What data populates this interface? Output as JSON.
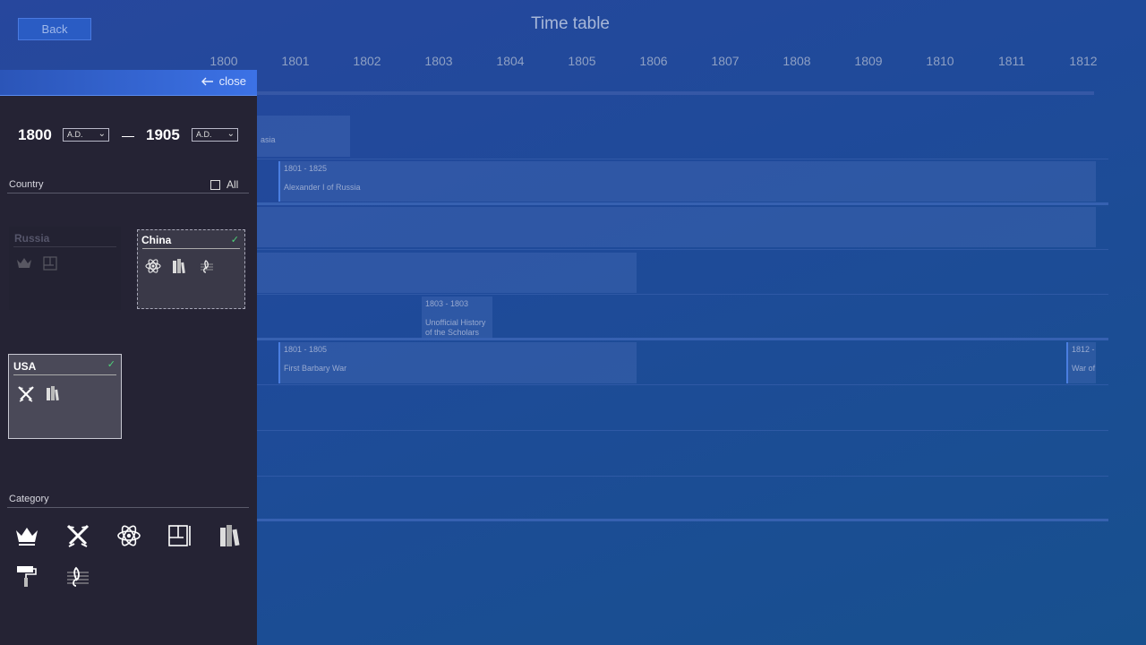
{
  "header": {
    "back_label": "Back",
    "title": "Time table"
  },
  "timeline": {
    "years": [
      "1800",
      "1801",
      "1802",
      "1803",
      "1804",
      "1805",
      "1806",
      "1807",
      "1808",
      "1809",
      "1810",
      "1811",
      "1812"
    ],
    "events": [
      {
        "dates": "",
        "name": "asia"
      },
      {
        "dates": "1801 - 1825",
        "name": "Alexander I of Russia"
      },
      {
        "dates": "1803 - 1803",
        "name": "Unofficial History of the Scholars"
      },
      {
        "dates": "1801 - 1805",
        "name": "First Barbary War"
      },
      {
        "dates": "1812 -",
        "name": "War of"
      }
    ]
  },
  "filter": {
    "close_label": "close",
    "start_year": "1800",
    "start_era": "A.D.",
    "end_year": "1905",
    "end_era": "A.D.",
    "country_label": "Country",
    "all_label": "All",
    "countries": [
      {
        "name": "Russia",
        "selected": false,
        "icons": [
          "crown-icon",
          "map-icon"
        ]
      },
      {
        "name": "China",
        "selected": true,
        "icons": [
          "atom-icon",
          "books-icon",
          "music-icon"
        ]
      },
      {
        "name": "USA",
        "selected": true,
        "icons": [
          "crossed-swords-icon",
          "books-icon"
        ]
      }
    ],
    "check_mark": "✓",
    "category_label": "Category",
    "categories": [
      "crown-icon",
      "crossed-swords-icon",
      "atom-icon",
      "map-icon",
      "books-icon",
      "paint-roller-icon",
      "music-icon"
    ]
  },
  "colors": {
    "accent": "#3c72e6",
    "panel": "#252334",
    "check": "#4fd27a"
  }
}
